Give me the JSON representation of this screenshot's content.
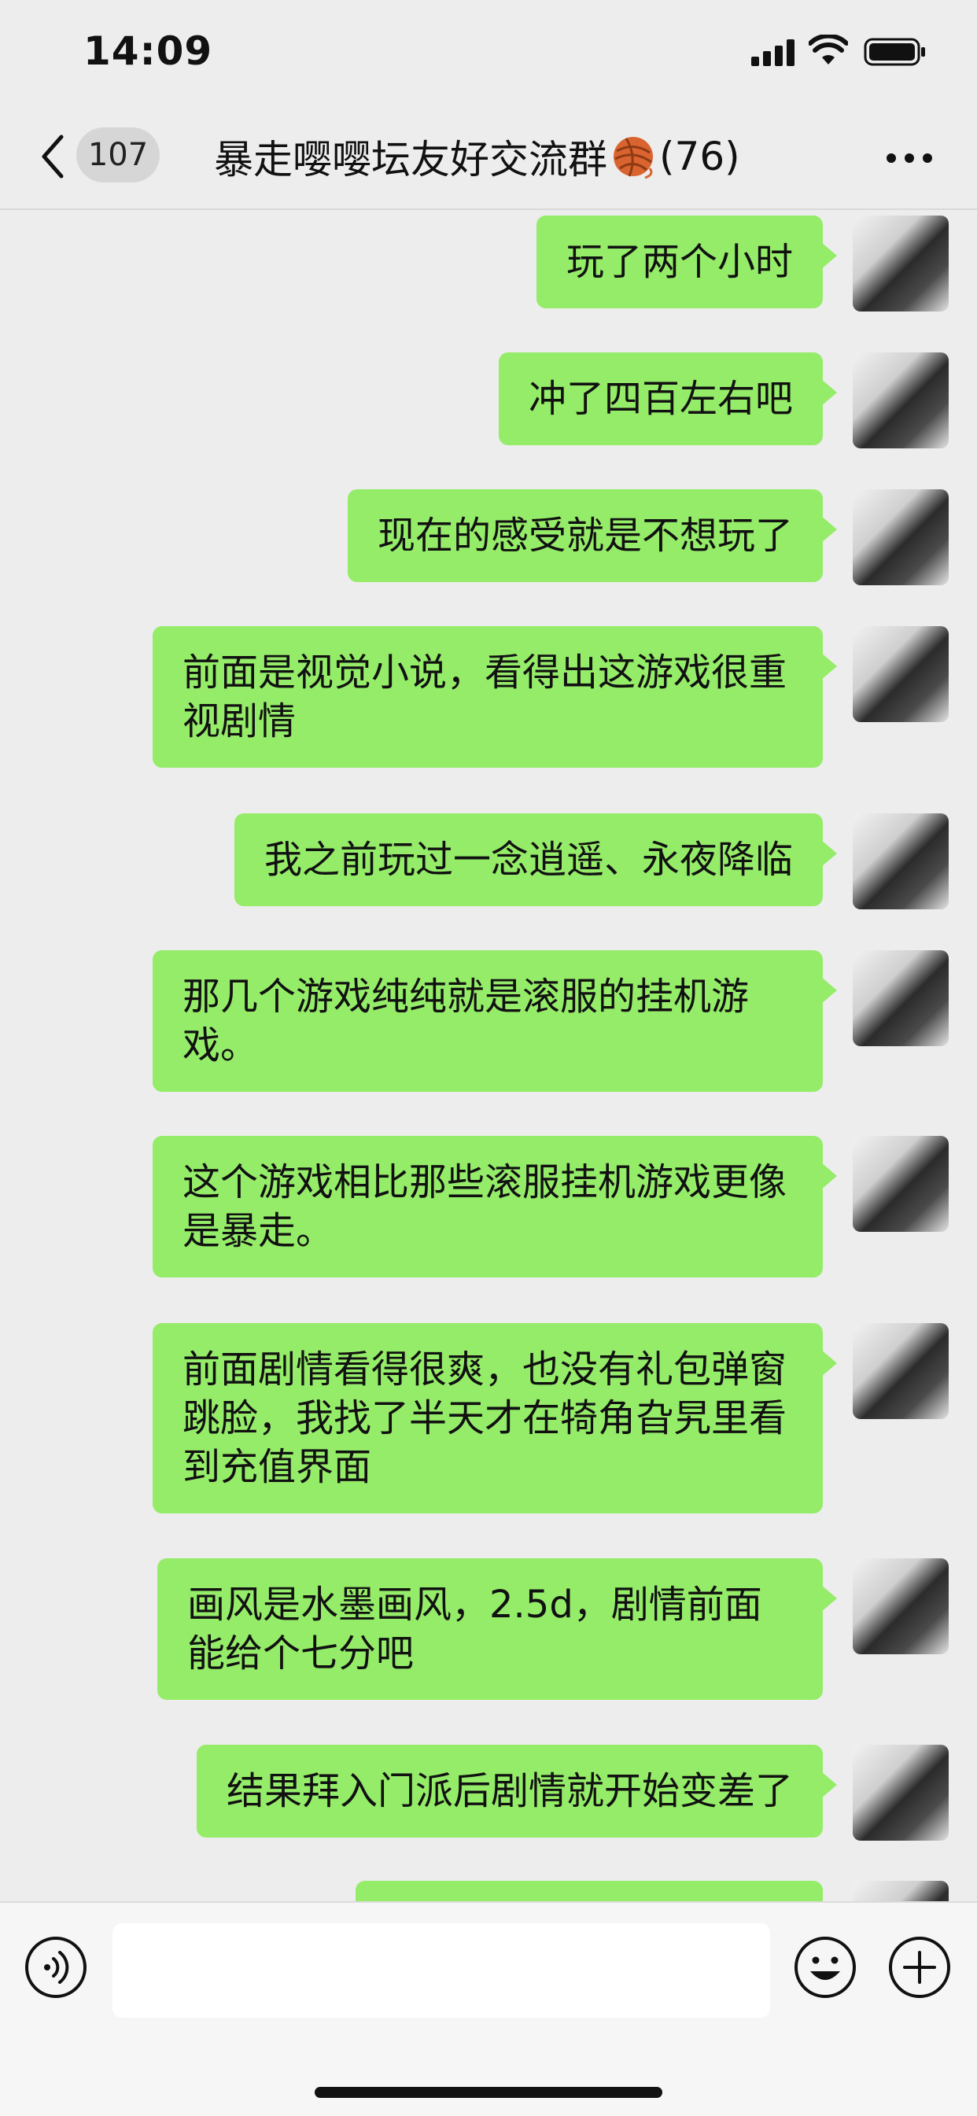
{
  "status_bar": {
    "time": "14:09"
  },
  "nav": {
    "back_count": "107",
    "group_name": "暴走嘤嘤坛友好交流群",
    "member_count": "(76)"
  },
  "messages": [
    "玩了两个小时",
    "冲了四百左右吧",
    "现在的感受就是不想玩了",
    "前面是视觉小说，看得出这游戏很重视剧情",
    "我之前玩过一念逍遥、永夜降临",
    "那几个游戏纯纯就是滚服的挂机游戏。",
    "这个游戏相比那些滚服挂机游戏更像是暴走。",
    "前面剧情看得很爽，也没有礼包弹窗跳脸，我找了半天才在犄角旮旯里看到充值界面",
    "画风是水墨画风，2.5d，剧情前面能给个七分吧",
    "结果拜入门派后剧情就开始变差了",
    ""
  ],
  "icons": {
    "back": "chevron-left-icon",
    "group_emoji": "yarn-ball-icon",
    "more": "more-dots-icon",
    "voice": "voice-icon",
    "emoji": "emoji-icon",
    "plus": "plus-icon"
  },
  "colors": {
    "bubble": "#95ec69",
    "background": "#ededed"
  }
}
